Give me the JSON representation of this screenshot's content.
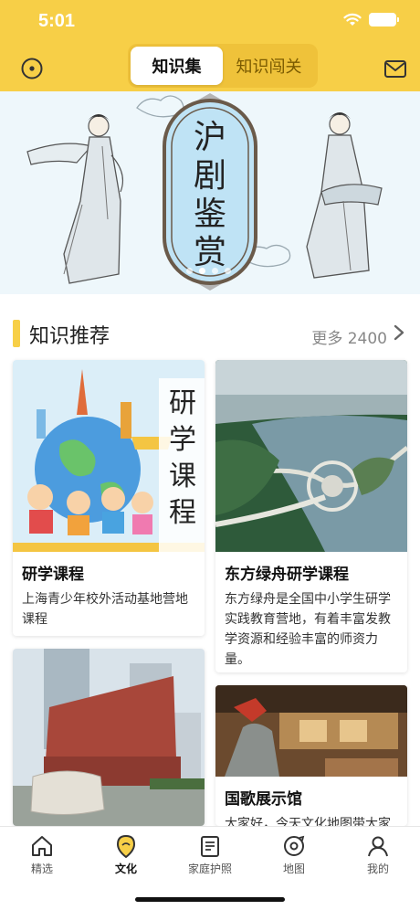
{
  "status_bar": {
    "time": "5:01"
  },
  "header": {
    "tabs": [
      {
        "label": "知识集",
        "active": true
      },
      {
        "label": "知识闯关",
        "active": false
      }
    ],
    "left_icon": "target-icon",
    "right_icon": "mail-icon"
  },
  "banner": {
    "text": "沪剧鉴赏",
    "page_count": 4,
    "active_page": 2
  },
  "section": {
    "title": "知识推荐",
    "more": "更多 2400"
  },
  "cards": [
    {
      "title": "研学课程",
      "description": "上海青少年校外活动基地营地课程",
      "image_text": "研学课程"
    },
    {
      "title": "东方绿舟研学课程",
      "description": "东方绿舟是全国中小学生研学实践教育营地，有着丰富发教学资源和经验丰富的师资力量。"
    },
    {
      "title": "",
      "description": "",
      "stone_text": ""
    },
    {
      "title": "国歌展示馆",
      "description": "大家好，今天文化地图带大家"
    }
  ],
  "tabbar": {
    "items": [
      {
        "label": "精选",
        "icon": "home-icon",
        "active": false
      },
      {
        "label": "文化",
        "icon": "culture-icon",
        "active": true
      },
      {
        "label": "家庭护照",
        "icon": "passport-icon",
        "active": false
      },
      {
        "label": "地图",
        "icon": "map-icon",
        "active": false
      },
      {
        "label": "我的",
        "icon": "profile-icon",
        "active": false
      }
    ]
  },
  "colors": {
    "brand_yellow": "#f7cf47",
    "text_dark": "#222222",
    "text_muted": "#888888"
  }
}
